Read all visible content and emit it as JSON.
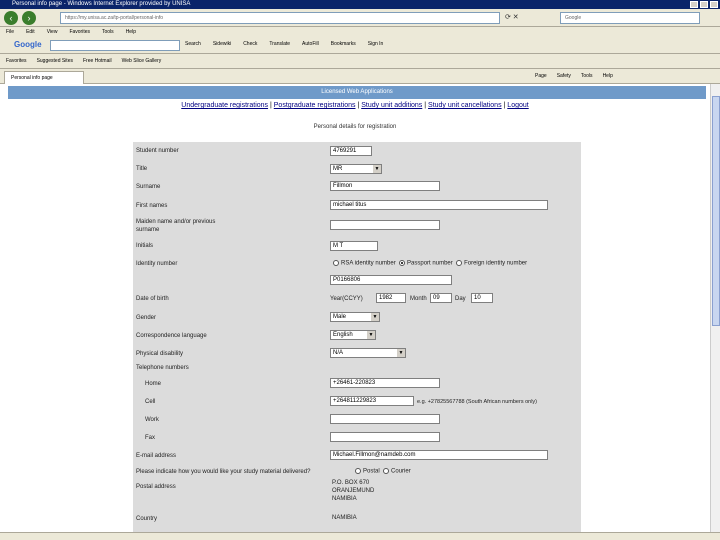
{
  "browser": {
    "title": "Personal info page - Windows Internet Explorer provided by UNISA",
    "address": "https://my.unisa.ac.za/tp-portal/personal-info",
    "search_box": "Google",
    "menu": [
      "File",
      "Edit",
      "View",
      "Favorites",
      "Tools",
      "Help"
    ],
    "google_toolbar": {
      "logo": "Google",
      "items": [
        "Search",
        "Sidewiki",
        "Check",
        "Translate",
        "AutoFill",
        "Bookmarks",
        "Sign In"
      ]
    },
    "favorites": [
      "Favorites",
      "Suggested Sites",
      "Free Hotmail",
      "Web Slice Gallery"
    ],
    "tab": "Personal info page",
    "command_bar": [
      "Page",
      "Safety",
      "Tools",
      "Help"
    ]
  },
  "page": {
    "banner": "Licensed Web Applications",
    "nav_links": [
      "Undergraduate registrations",
      "Postgraduate registrations",
      "Study unit additions",
      "Study unit cancellations",
      "Logout"
    ],
    "subtitle": "Personal details for registration"
  },
  "form": {
    "student_number": {
      "label": "Student number",
      "value": "4769291"
    },
    "title": {
      "label": "Title",
      "value": "MR"
    },
    "surname": {
      "label": "Surname",
      "value": "Fillmon"
    },
    "first_names": {
      "label": "First names",
      "value": "michael titus"
    },
    "maiden_name": {
      "label": "Maiden name and/or previous surname",
      "value": ""
    },
    "initials": {
      "label": "Initials",
      "value": "M T"
    },
    "identity": {
      "label": "Identity number",
      "options": [
        "RSA identity number",
        "Passport number",
        "Foreign identity number"
      ],
      "selected": "Passport number",
      "value": "P0166806"
    },
    "dob": {
      "label": "Date of birth",
      "year_label": "Year(CCYY)",
      "year": "1982",
      "month_label": "Month",
      "month": "09",
      "day_label": "Day",
      "day": "10"
    },
    "gender": {
      "label": "Gender",
      "value": "Male"
    },
    "language": {
      "label": "Correspondence language",
      "value": "English"
    },
    "disability": {
      "label": "Physical disability",
      "value": "N/A"
    },
    "telephone": {
      "label": "Telephone numbers",
      "home": {
        "label": "Home",
        "value": "+26461-220823"
      },
      "cell": {
        "label": "Cell",
        "value": "+264811229823",
        "hint": "e.g. +27825567788 (South African numbers only)"
      },
      "work": {
        "label": "Work",
        "value": ""
      },
      "fax": {
        "label": "Fax",
        "value": ""
      }
    },
    "email": {
      "label": "E-mail address",
      "value": "Michael.Fillmon@namdeb.com"
    },
    "delivery": {
      "label": "Please indicate how you would like your study material delivered?",
      "options": [
        "Postal",
        "Courier"
      ]
    },
    "postal_address": {
      "label": "Postal address",
      "lines": [
        "P.O. BOX 670",
        "ORANJEMUND",
        "NAMIBIA"
      ]
    },
    "country": {
      "label": "Country",
      "value": "NAMIBIA"
    }
  }
}
